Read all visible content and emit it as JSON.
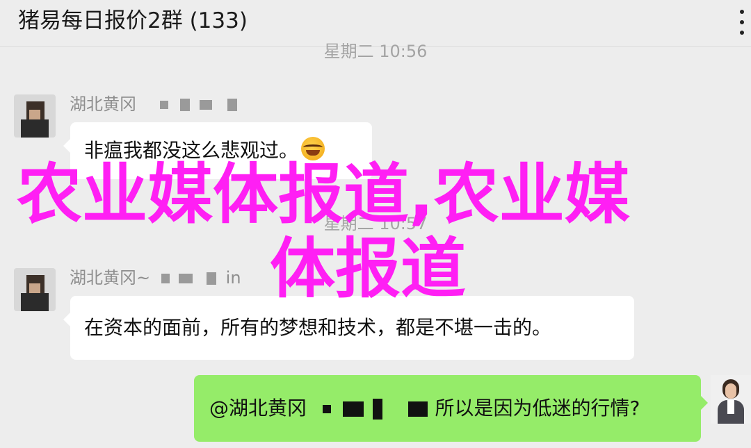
{
  "header": {
    "title": "猪易每日报价2群 (133)"
  },
  "timestamps": [
    "星期二 10:56",
    "星期二 10:57"
  ],
  "messages": [
    {
      "sender": "湖北黄冈",
      "text": "非瘟我都没这么悲观过。",
      "emoji": "crying-laughing-emoji",
      "side": "left"
    },
    {
      "sender": "湖北黄冈~",
      "sender_tail": "in",
      "text": "在资本的面前，所有的梦想和技术，都是不堪一击的。",
      "side": "left"
    },
    {
      "mention": "@湖北黄冈",
      "text": "所以是因为低迷的行情?",
      "side": "right"
    }
  ],
  "overlay": {
    "line1": "农业媒体报道,农业媒",
    "line2": "体报道",
    "color": "#ff1ff4"
  },
  "colors": {
    "background": "#ededed",
    "bubble_in": "#ffffff",
    "bubble_out": "#95ec69"
  }
}
